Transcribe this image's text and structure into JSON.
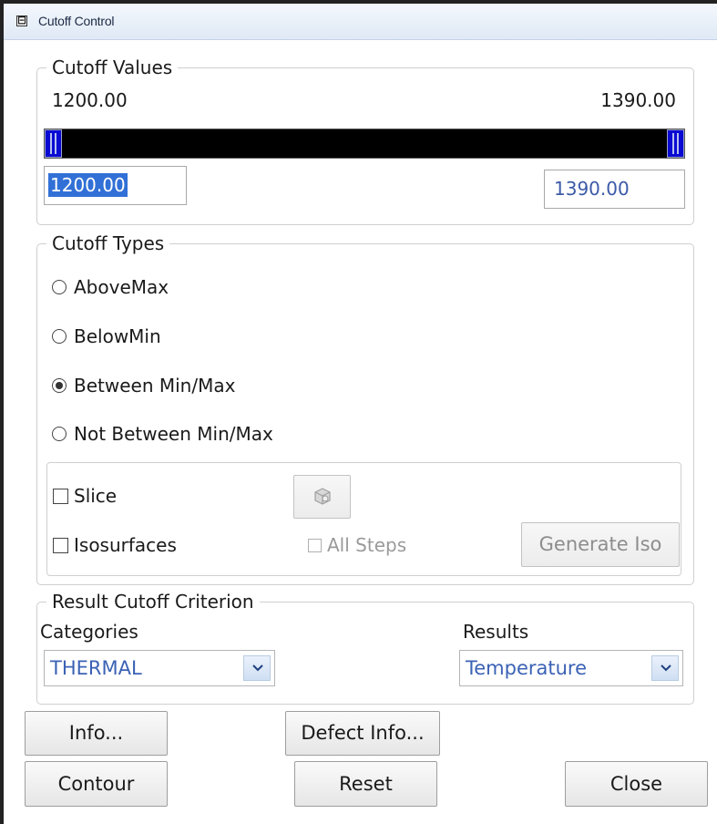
{
  "window": {
    "title": "Cutoff Control",
    "collapse_glyph": "⊟"
  },
  "cutoff_values": {
    "legend": "Cutoff Values",
    "min_label": "1200.00",
    "max_label": "1390.00",
    "min_input": "1200.00",
    "max_input": "1390.00",
    "slider_low_fraction": 0.0,
    "slider_high_fraction": 1.0,
    "slider_colors": {
      "track": "#000000",
      "thumb": "#0a0ad2"
    }
  },
  "cutoff_types": {
    "legend": "Cutoff Types",
    "options": [
      {
        "label": "AboveMax",
        "selected": false
      },
      {
        "label": "BelowMin",
        "selected": false
      },
      {
        "label": "Between Min/Max",
        "selected": true
      },
      {
        "label": "Not Between Min/Max",
        "selected": false
      }
    ],
    "slice_label": "Slice",
    "slice_checked": false,
    "isosurfaces_label": "Isosurfaces",
    "isosurfaces_checked": false,
    "all_steps_label": "All Steps",
    "all_steps_enabled": false,
    "slice_icon": "cube-settings-icon",
    "generate_iso_label": "Generate Iso"
  },
  "result_criterion": {
    "legend": "Result Cutoff Criterion",
    "categories_label": "Categories",
    "categories_value": "THERMAL",
    "results_label": "Results",
    "results_value": "Temperature"
  },
  "buttons": {
    "info": "Info...",
    "defect_info": "Defect Info...",
    "contour": "Contour",
    "reset": "Reset",
    "close": "Close"
  }
}
